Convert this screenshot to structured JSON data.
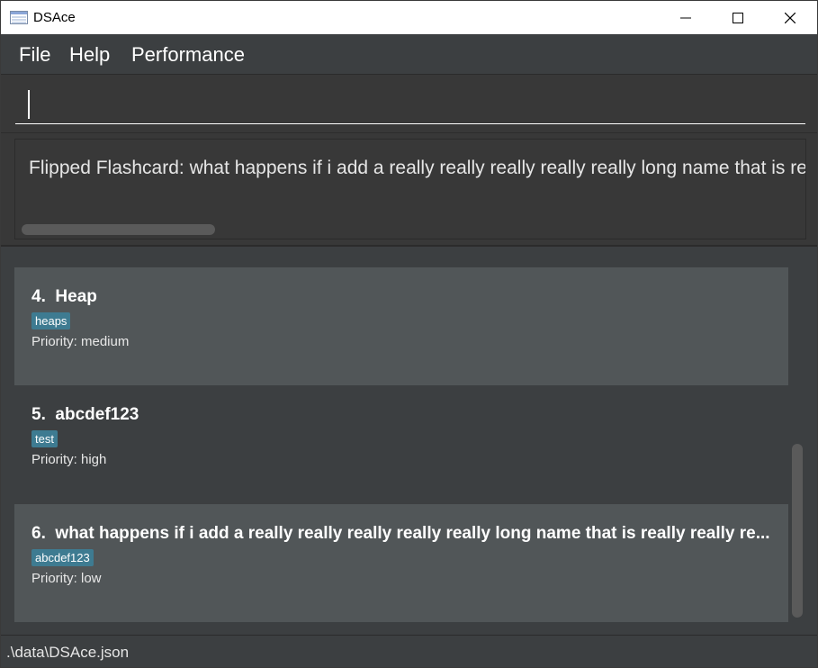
{
  "window": {
    "title": "DSAce",
    "controls": [
      "minimize-icon",
      "maximize-icon",
      "close-icon"
    ]
  },
  "menu": {
    "items": [
      {
        "label": "File"
      },
      {
        "label": "Help"
      },
      {
        "label": "Performance"
      }
    ]
  },
  "command": {
    "value": ""
  },
  "result": {
    "text": "Flipped Flashcard: what happens if i add a really really really really really long name that is really really really really really long"
  },
  "flashcards": [
    {
      "index": "4.",
      "name": "Heap",
      "tag": "heaps",
      "priority": "Priority: medium"
    },
    {
      "index": "5.",
      "name": "abcdef123",
      "tag": "test",
      "priority": "Priority: high"
    },
    {
      "index": "6.",
      "name": "what happens if i add a really really really really really long name that is really really re...",
      "tag": "abcdef123",
      "priority": "Priority: low"
    }
  ],
  "status": {
    "path": ".\\data\\DSAce.json"
  },
  "colors": {
    "background": "#3c3f41",
    "card_light": "#515658",
    "tag": "#3e7b91"
  }
}
